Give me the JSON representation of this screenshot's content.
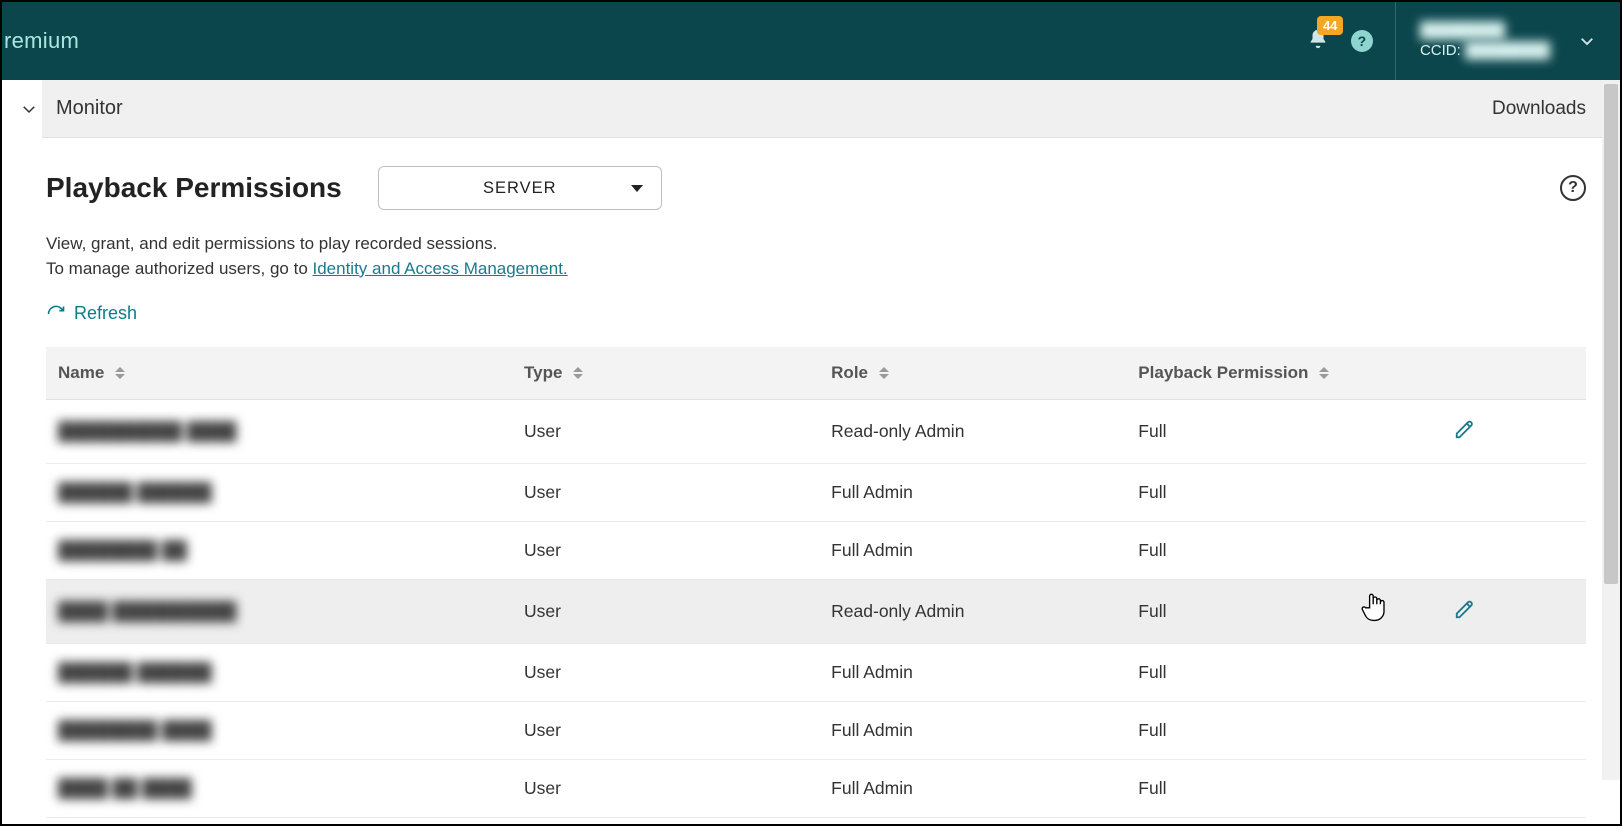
{
  "header": {
    "product_suffix": "remium",
    "notifications_count": "44",
    "profile_name": "████████",
    "ccid_label": "CCID:",
    "ccid_value": "████████"
  },
  "secondbar": {
    "title": "Monitor",
    "downloads": "Downloads"
  },
  "page": {
    "title": "Playback Permissions",
    "server_label": "SERVER",
    "desc_line1": "View, grant, and edit permissions to play recorded sessions.",
    "desc_line2_prefix": "To manage authorized users, go to  ",
    "desc_link": "Identity and Access Management.",
    "refresh": "Refresh"
  },
  "columns": {
    "name": "Name",
    "type": "Type",
    "role": "Role",
    "perm": "Playback Permission"
  },
  "rows": [
    {
      "name": "██████████ ████",
      "type": "User",
      "role": "Read-only Admin",
      "perm": "Full",
      "edit": true,
      "hovered": false
    },
    {
      "name": "██████ ██████",
      "type": "User",
      "role": "Full Admin",
      "perm": "Full",
      "edit": false,
      "hovered": false
    },
    {
      "name": "████████ ██",
      "type": "User",
      "role": "Full Admin",
      "perm": "Full",
      "edit": false,
      "hovered": false
    },
    {
      "name": "████ ██████████",
      "type": "User",
      "role": "Read-only Admin",
      "perm": "Full",
      "edit": true,
      "hovered": true
    },
    {
      "name": "██████ ██████",
      "type": "User",
      "role": "Full Admin",
      "perm": "Full",
      "edit": false,
      "hovered": false
    },
    {
      "name": "████████ ████",
      "type": "User",
      "role": "Full Admin",
      "perm": "Full",
      "edit": false,
      "hovered": false
    },
    {
      "name": "████ ██   ████",
      "type": "User",
      "role": "Full Admin",
      "perm": "Full",
      "edit": false,
      "hovered": false
    }
  ]
}
